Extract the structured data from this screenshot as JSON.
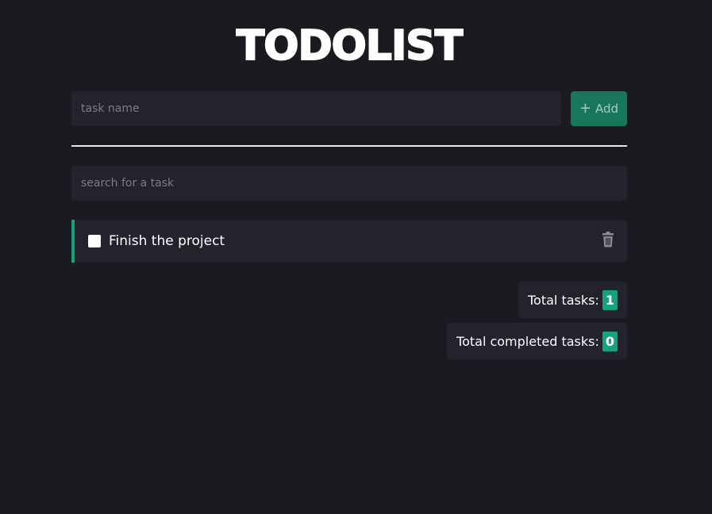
{
  "header": {
    "title": "TODOLIST"
  },
  "new_task": {
    "placeholder": "task name",
    "add_label": "Add",
    "add_icon": "plus-icon"
  },
  "search": {
    "placeholder": "search for a task"
  },
  "tasks": [
    {
      "label": "Finish the project",
      "completed": false,
      "delete_icon": "trash-icon"
    }
  ],
  "stats": {
    "total_label": "Total tasks:",
    "total_value": "1",
    "completed_label": "Total completed tasks:",
    "completed_value": "0"
  },
  "colors": {
    "background": "#1a1a21",
    "surface": "#23232b",
    "accent": "#16a37b",
    "add_button": "#16775a"
  }
}
